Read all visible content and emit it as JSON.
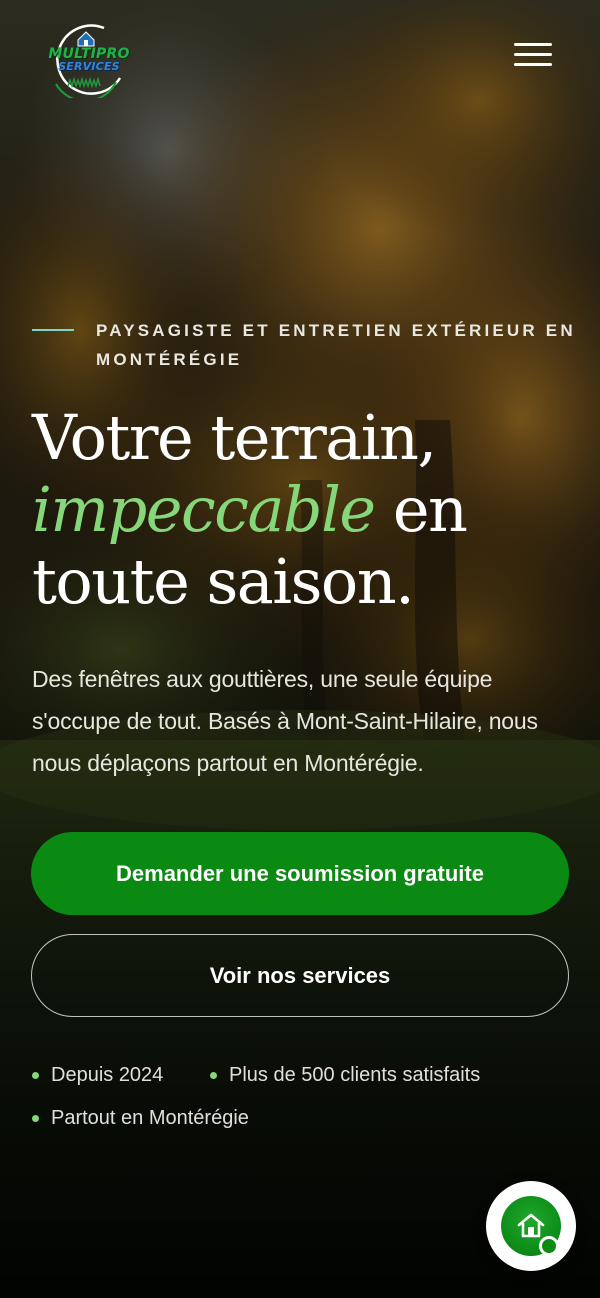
{
  "brand": {
    "logo_line_1": "MULTIPRO",
    "logo_line_2": "SERVICES",
    "colors": {
      "green": "#22b14c",
      "blue": "#2e86e0"
    }
  },
  "header": {
    "menu_icon": "hamburger-menu-icon"
  },
  "hero": {
    "eyebrow": "PAYSAGISTE ET ENTRETIEN EXTÉRIEUR EN MONTÉRÉGIE",
    "headline_part_1": "Votre terrain,",
    "headline_accent": "impeccable",
    "headline_part_2": " en toute saison.",
    "lead": "Des fenêtres aux gouttières, une seule équipe s'occupe de tout. Basés à Mont-Saint-Hilaire, nous nous déplaçons partout en Montérégie.",
    "primary_cta": "Demander une soumission gratuite",
    "secondary_cta": "Voir nos services",
    "facts": [
      {
        "label": "Depuis 2024"
      },
      {
        "label": "Plus de 500 clients satisfaits"
      },
      {
        "label": "Partout en Montérégie"
      }
    ],
    "colors": {
      "accent_green": "#86d77a",
      "cta_green": "#0a8a12",
      "eyebrow_line": "#7fd6c8"
    }
  },
  "floating_action": {
    "icon": "home-icon"
  }
}
